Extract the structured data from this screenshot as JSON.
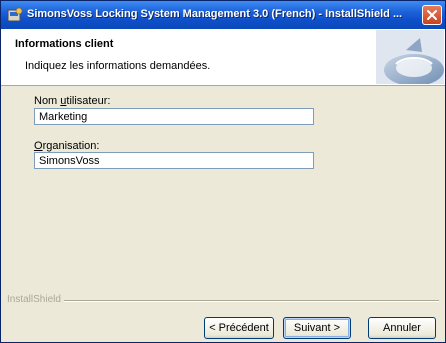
{
  "window": {
    "title": "SimonsVoss Locking System Management 3.0 (French) - InstallShield ..."
  },
  "header": {
    "title": "Informations client",
    "subtitle": "Indiquez les informations demandées."
  },
  "form": {
    "username": {
      "label_prefix": "Nom ",
      "label_accel": "u",
      "label_rest": "tilisateur:",
      "value": "Marketing"
    },
    "organization": {
      "label_accel": "O",
      "label_rest": "rganisation:",
      "value": "SimonsVoss"
    }
  },
  "footer": {
    "brand": "InstallShield",
    "previous": "< Précédent",
    "next": "Suivant >",
    "cancel": "Annuler"
  }
}
